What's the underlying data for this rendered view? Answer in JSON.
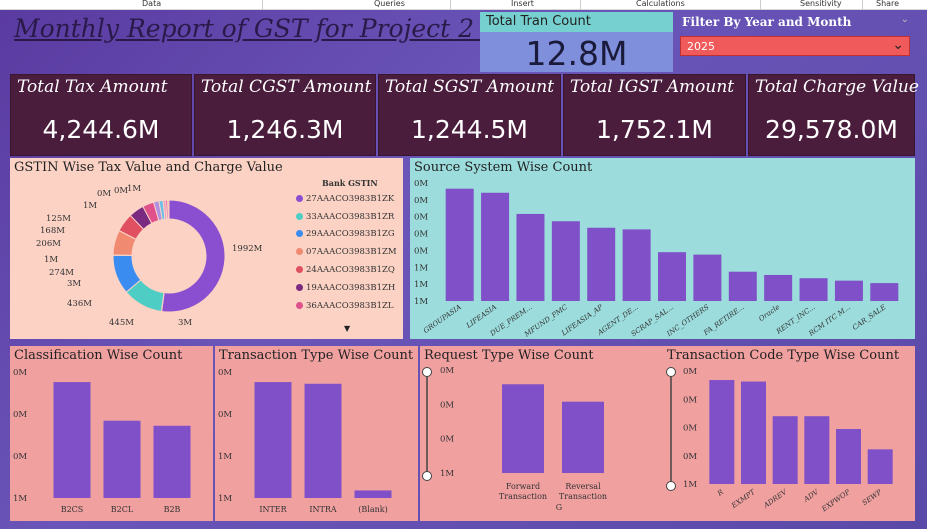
{
  "menubar": {
    "items": [
      "Data",
      "Queries",
      "Insert",
      "Calculations",
      "Sensitivity",
      "Share"
    ]
  },
  "header": {
    "title": "Monthly Report of GST for Project 2 :"
  },
  "tran_count": {
    "label": "Total Tran Count",
    "value": "12.8M"
  },
  "filter": {
    "label": "Filter By Year and Month",
    "selected": "2025"
  },
  "kpis": [
    {
      "label": "Total Tax Amount",
      "value": "4,244.6M"
    },
    {
      "label": "Total CGST Amount",
      "value": "1,246.3M"
    },
    {
      "label": "Total SGST Amount",
      "value": "1,244.5M"
    },
    {
      "label": "Total IGST Amount",
      "value": "1,752.1M"
    },
    {
      "label": "Total Charge Value",
      "value": "29,578.0M"
    }
  ],
  "colors": {
    "accent": "#8050c8",
    "kpi_bg": "#4a1d3d"
  },
  "panels": {
    "gstin": {
      "title": "GSTIN Wise Tax Value and Charge Value",
      "legend_title": "Bank GSTIN"
    },
    "source": {
      "title": "Source System Wise Count"
    },
    "classification": {
      "title": "Classification Wise Count"
    },
    "transaction_type": {
      "title": "Transaction Type Wise Count"
    },
    "request_type": {
      "title": "Request Type Wise Count"
    },
    "transaction_code": {
      "title": "Transaction Code Type Wise Count"
    }
  },
  "chart_data": [
    {
      "type": "pie",
      "title": "GSTIN Wise Tax Value and Charge Value",
      "legend_title": "Bank GSTIN",
      "legend": [
        {
          "name": "27AAACO3983B1ZK",
          "color": "#8a4fd0"
        },
        {
          "name": "33AAACO3983B1ZR",
          "color": "#4ecdc4"
        },
        {
          "name": "29AAACO3983B1ZG",
          "color": "#3b8cf0"
        },
        {
          "name": "07AAACO3983B1ZM",
          "color": "#f08a70"
        },
        {
          "name": "24AAACO3983B1ZQ",
          "color": "#e05060"
        },
        {
          "name": "19AAACO3983B1ZH",
          "color": "#7a2a80"
        },
        {
          "name": "36AAACO3983B1ZL",
          "color": "#e0508a"
        }
      ],
      "slice_labels": [
        "1992M",
        "3M",
        "445M",
        "436M",
        "3M",
        "274M",
        "1M",
        "206M",
        "168M",
        "125M",
        "1M",
        "0M",
        "0M",
        "1M"
      ],
      "slices": [
        {
          "value": 1992,
          "color": "#8a4fd0"
        },
        {
          "value": 3,
          "color": "#4ecdc4"
        },
        {
          "value": 445,
          "color": "#4ecdc4"
        },
        {
          "value": 436,
          "color": "#3b8cf0"
        },
        {
          "value": 3,
          "color": "#3b8cf0"
        },
        {
          "value": 274,
          "color": "#f08a70"
        },
        {
          "value": 1,
          "color": "#e05060"
        },
        {
          "value": 206,
          "color": "#e05060"
        },
        {
          "value": 168,
          "color": "#7a2a80"
        },
        {
          "value": 125,
          "color": "#e0508a"
        },
        {
          "value": 60,
          "color": "#b090e0"
        },
        {
          "value": 45,
          "color": "#6cc0e8"
        },
        {
          "value": 30,
          "color": "#f0a0c0"
        },
        {
          "value": 20,
          "color": "#d040a0"
        },
        {
          "value": 15,
          "color": "#f0c070"
        }
      ]
    },
    {
      "type": "bar",
      "title": "Source System Wise Count",
      "categories": [
        "GROUPASIA",
        "LIFEASIA",
        "DUE_PREM...",
        "MFUND_PMC",
        "LIFEASIA_AP",
        "AGENT_DE...",
        "SCRAP_SAL...",
        "INC_OTHERS",
        "FA_RETIRE...",
        "Oracle",
        "RENT_INC...",
        "RCM ITC M...",
        "CAR_SALE"
      ],
      "values": [
        1.38,
        1.33,
        1.07,
        0.98,
        0.9,
        0.88,
        0.6,
        0.57,
        0.36,
        0.32,
        0.28,
        0.25,
        0.22
      ],
      "ytick_labels": [
        "1M",
        "1M",
        "1M",
        "0M",
        "0M",
        "0M",
        "0M",
        "0M"
      ],
      "ylim": [
        0,
        1.45
      ]
    },
    {
      "type": "bar",
      "title": "Classification Wise Count",
      "categories": [
        "B2CS",
        "B2CL",
        "B2B"
      ],
      "values": [
        1.38,
        0.92,
        0.86
      ],
      "ytick_labels": [
        "1M",
        "0M",
        "0M",
        "0M"
      ],
      "ylim": [
        0,
        1.5
      ]
    },
    {
      "type": "bar",
      "title": "Transaction Type Wise Count",
      "categories": [
        "INTER",
        "INTRA",
        "(Blank)"
      ],
      "values": [
        1.38,
        1.36,
        0.09
      ],
      "ytick_labels": [
        "1M",
        "1M",
        "0M",
        "0M"
      ],
      "ylim": [
        0,
        1.5
      ]
    },
    {
      "type": "bar",
      "title": "Request Type Wise Count",
      "categories": [
        "Forward Transaction",
        "Reversal Transaction"
      ],
      "values": [
        1.12,
        0.9
      ],
      "ytick_labels": [
        "1M",
        "0M",
        "0M",
        "0M"
      ],
      "ylim": [
        0,
        1.3
      ],
      "xlabel": "G"
    },
    {
      "type": "bar",
      "title": "Transaction Code Type Wise Count",
      "categories": [
        "R",
        "EXMPT",
        "ADREV",
        "ADV",
        "EXPWOP",
        "SEWP"
      ],
      "values": [
        1.38,
        1.36,
        0.9,
        0.9,
        0.73,
        0.46
      ],
      "ytick_labels": [
        "1M",
        "0M",
        "0M",
        "0M",
        "0M"
      ],
      "ylim": [
        0,
        1.5
      ]
    }
  ]
}
